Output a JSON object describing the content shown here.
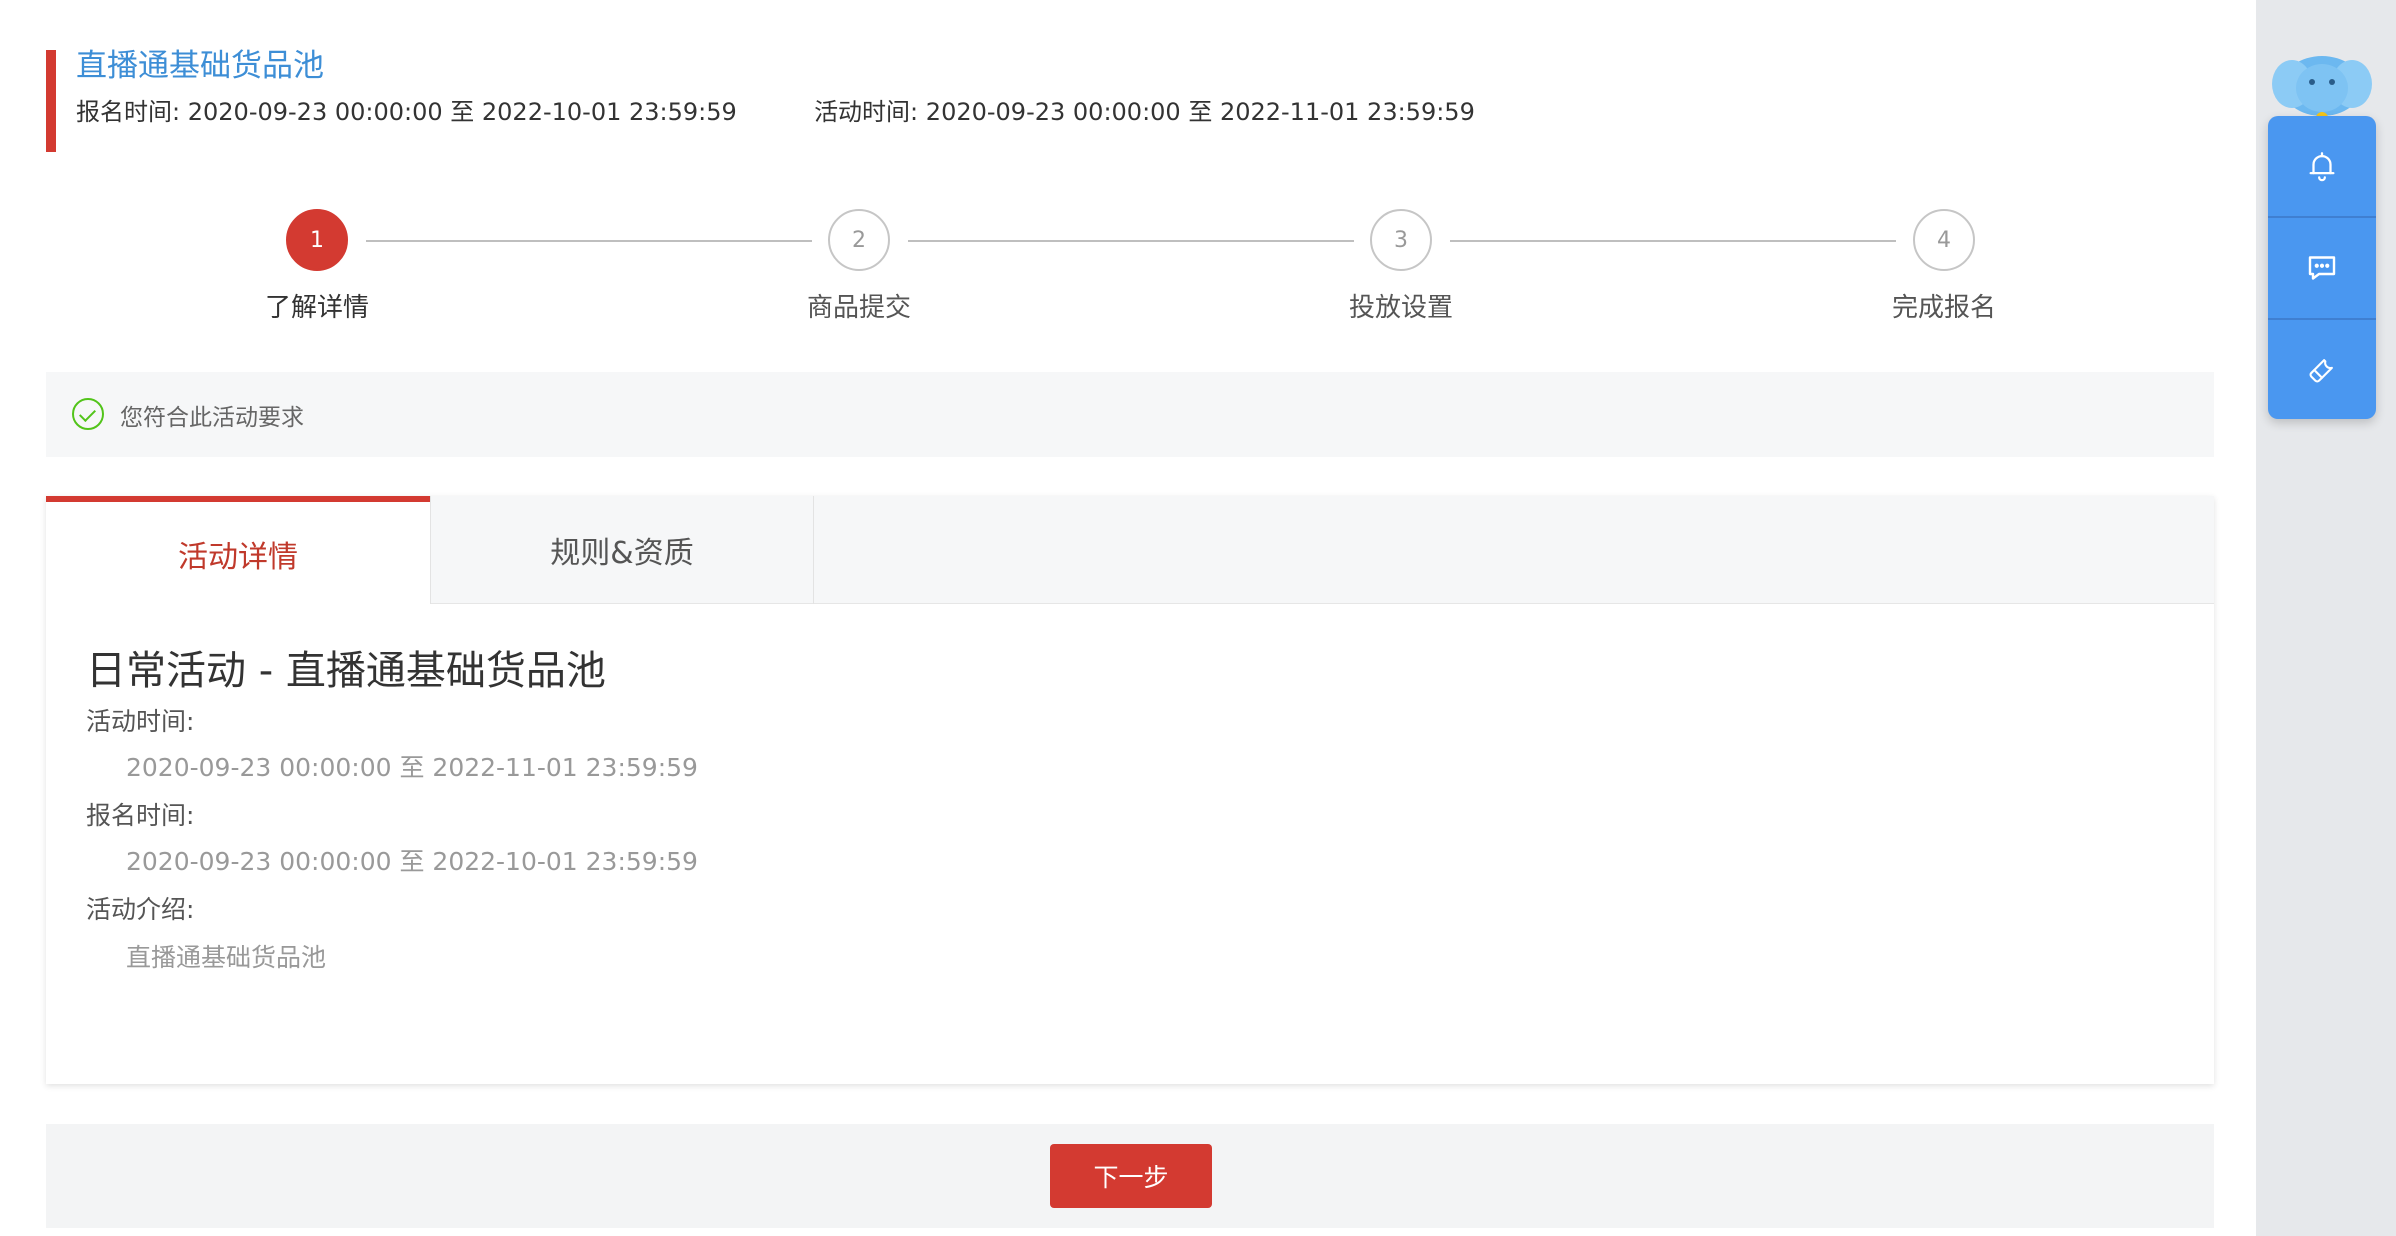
{
  "header": {
    "title": "直播通基础货品池",
    "signup_label": "报名时间:",
    "signup_range": "2020-09-23 00:00:00 至 2022-10-01 23:59:59",
    "activity_label": "活动时间:",
    "activity_range": "2020-09-23 00:00:00 至 2022-11-01 23:59:59"
  },
  "steps": [
    {
      "num": "1",
      "label": "了解详情",
      "active": true
    },
    {
      "num": "2",
      "label": "商品提交",
      "active": false
    },
    {
      "num": "3",
      "label": "投放设置",
      "active": false
    },
    {
      "num": "4",
      "label": "完成报名",
      "active": false
    }
  ],
  "notice": {
    "text": "您符合此活动要求",
    "icon": "check-circle-icon",
    "color": "#52c41a"
  },
  "tabs": [
    {
      "label": "活动详情",
      "active": true
    },
    {
      "label": "规则&资质",
      "active": false
    }
  ],
  "details": {
    "title": "日常活动 - 直播通基础货品池",
    "activity_time_label": "活动时间:",
    "activity_time_value": "2020-09-23 00:00:00 至 2022-11-01 23:59:59",
    "signup_time_label": "报名时间:",
    "signup_time_value": "2020-09-23 00:00:00 至 2022-10-01 23:59:59",
    "intro_label": "活动介绍:",
    "intro_value": "直播通基础货品池"
  },
  "footer": {
    "next_label": "下一步"
  },
  "tools": [
    {
      "icon": "bell-icon"
    },
    {
      "icon": "message-icon"
    },
    {
      "icon": "wrench-icon"
    }
  ],
  "colors": {
    "accent": "#d33a31",
    "link": "#3d8ed6",
    "tool_panel": "#4a97f0"
  }
}
